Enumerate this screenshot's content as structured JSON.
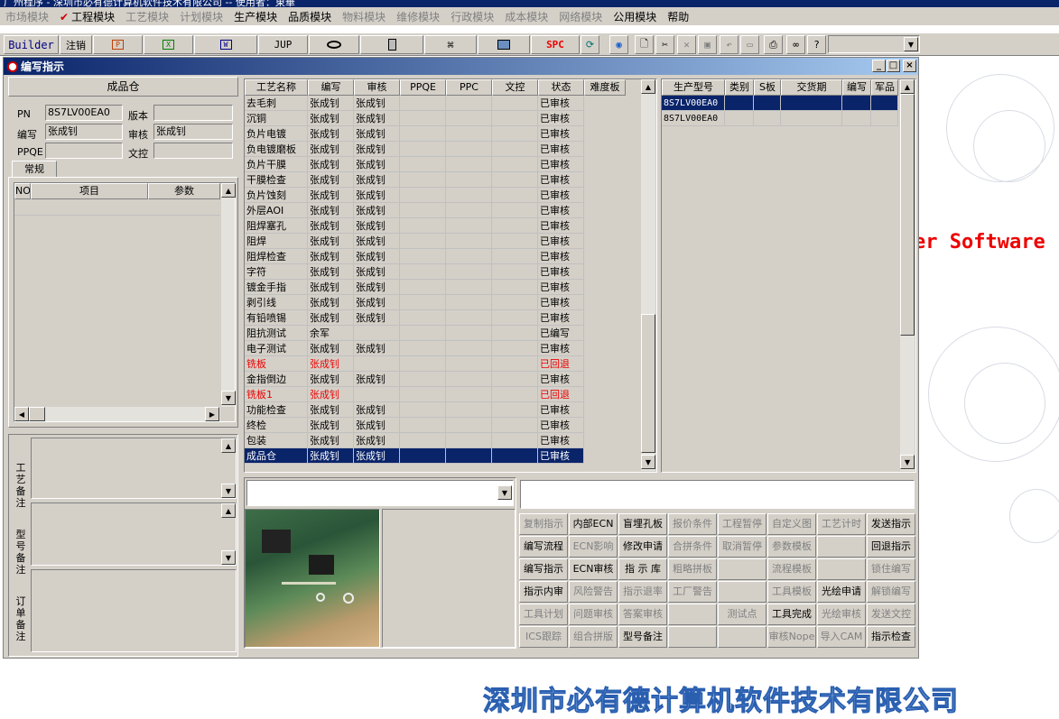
{
  "app_title": "广州程序 - 深圳市必有德计算机软件技术有限公司 -- 使用者：東華",
  "menu": [
    {
      "label": "市场模块",
      "enabled": false
    },
    {
      "label": "工程模块",
      "enabled": true,
      "checked": true
    },
    {
      "label": "工艺模块",
      "enabled": false
    },
    {
      "label": "计划模块",
      "enabled": false
    },
    {
      "label": "生产模块",
      "enabled": true
    },
    {
      "label": "品质模块",
      "enabled": true
    },
    {
      "label": "物料模块",
      "enabled": false
    },
    {
      "label": "维修模块",
      "enabled": false
    },
    {
      "label": "行政模块",
      "enabled": false
    },
    {
      "label": "成本模块",
      "enabled": false
    },
    {
      "label": "网络模块",
      "enabled": false
    },
    {
      "label": "公用模块",
      "enabled": true
    },
    {
      "label": "帮助",
      "enabled": true
    }
  ],
  "toolbar": {
    "builder": "Builder",
    "logout": "注销",
    "jup": "JUP",
    "spc": "SPC"
  },
  "window_title": "编写指示",
  "left": {
    "header": "成品仓",
    "pn_label": "PN",
    "pn_value": "8S7LV00EA0",
    "version_label": "版本",
    "version_value": "",
    "writer_label": "编写",
    "writer_value": "张成钊",
    "reviewer_label": "审核",
    "reviewer_value": "张成钊",
    "ppqe_label": "PPQE",
    "ppqe_value": "",
    "doc_label": "文控",
    "doc_value": "",
    "tab": "常规",
    "grid_cols": [
      "NO",
      "项目",
      "参数"
    ],
    "memo_labels": [
      "工艺备注",
      "型号备注",
      "订单备注"
    ]
  },
  "process_grid": {
    "columns": [
      "工艺名称",
      "编写",
      "审核",
      "PPQE",
      "PPC",
      "文控",
      "状态",
      "难度板"
    ],
    "rows": [
      {
        "name": "去毛刺",
        "writer": "张成钊",
        "reviewer": "张成钊",
        "status": "已审核"
      },
      {
        "name": "沉铜",
        "writer": "张成钊",
        "reviewer": "张成钊",
        "status": "已审核"
      },
      {
        "name": "负片电镀",
        "writer": "张成钊",
        "reviewer": "张成钊",
        "status": "已审核"
      },
      {
        "name": "负电镀磨板",
        "writer": "张成钊",
        "reviewer": "张成钊",
        "status": "已审核"
      },
      {
        "name": "负片干膜",
        "writer": "张成钊",
        "reviewer": "张成钊",
        "status": "已审核"
      },
      {
        "name": "干膜检查",
        "writer": "张成钊",
        "reviewer": "张成钊",
        "status": "已审核"
      },
      {
        "name": "负片蚀刻",
        "writer": "张成钊",
        "reviewer": "张成钊",
        "status": "已审核"
      },
      {
        "name": "外层AOI",
        "writer": "张成钊",
        "reviewer": "张成钊",
        "status": "已审核"
      },
      {
        "name": "阻焊塞孔",
        "writer": "张成钊",
        "reviewer": "张成钊",
        "status": "已审核"
      },
      {
        "name": "阻焊",
        "writer": "张成钊",
        "reviewer": "张成钊",
        "status": "已审核"
      },
      {
        "name": "阻焊检查",
        "writer": "张成钊",
        "reviewer": "张成钊",
        "status": "已审核"
      },
      {
        "name": "字符",
        "writer": "张成钊",
        "reviewer": "张成钊",
        "status": "已审核"
      },
      {
        "name": "镀金手指",
        "writer": "张成钊",
        "reviewer": "张成钊",
        "status": "已审核"
      },
      {
        "name": "剥引线",
        "writer": "张成钊",
        "reviewer": "张成钊",
        "status": "已审核"
      },
      {
        "name": "有铅喷锡",
        "writer": "张成钊",
        "reviewer": "张成钊",
        "status": "已审核"
      },
      {
        "name": "阻抗测试",
        "writer": "余军",
        "reviewer": "",
        "status": "已编写"
      },
      {
        "name": "电子测试",
        "writer": "张成钊",
        "reviewer": "张成钊",
        "status": "已审核"
      },
      {
        "name": "铣板",
        "writer": "张成钊",
        "reviewer": "",
        "status": "已回退",
        "red": true
      },
      {
        "name": "金指倒边",
        "writer": "张成钊",
        "reviewer": "张成钊",
        "status": "已审核"
      },
      {
        "name": "铣板1",
        "writer": "张成钊",
        "reviewer": "",
        "status": "已回退",
        "red": true
      },
      {
        "name": "功能检查",
        "writer": "张成钊",
        "reviewer": "张成钊",
        "status": "已审核"
      },
      {
        "name": "终检",
        "writer": "张成钊",
        "reviewer": "张成钊",
        "status": "已审核"
      },
      {
        "name": "包装",
        "writer": "张成钊",
        "reviewer": "张成钊",
        "status": "已审核"
      },
      {
        "name": "成品仓",
        "writer": "张成钊",
        "reviewer": "张成钊",
        "status": "已审核",
        "selected": true
      }
    ]
  },
  "model_grid": {
    "columns": [
      "生产型号",
      "类别",
      "S板",
      "交货期",
      "编写",
      "军品"
    ],
    "rows": [
      {
        "model": "8S7LV00EA0",
        "selected": true
      },
      {
        "model": "8S7LV00EA0",
        "selected": false
      }
    ]
  },
  "actions": [
    [
      {
        "label": "复制指示",
        "enabled": false
      },
      {
        "label": "内部ECN",
        "enabled": true
      },
      {
        "label": "盲埋孔板",
        "enabled": true
      },
      {
        "label": "报价条件",
        "enabled": false
      },
      {
        "label": "工程暂停",
        "enabled": false
      },
      {
        "label": "自定义图",
        "enabled": false
      },
      {
        "label": "工艺计时",
        "enabled": false
      },
      {
        "label": "发送指示",
        "enabled": true
      }
    ],
    [
      {
        "label": "编写流程",
        "enabled": true
      },
      {
        "label": "ECN影响",
        "enabled": false
      },
      {
        "label": "修改申请",
        "enabled": true
      },
      {
        "label": "合拼条件",
        "enabled": false
      },
      {
        "label": "取消暂停",
        "enabled": false
      },
      {
        "label": "参数模板",
        "enabled": false
      },
      {
        "label": "",
        "enabled": false
      },
      {
        "label": "回退指示",
        "enabled": true
      }
    ],
    [
      {
        "label": "编写指示",
        "enabled": true
      },
      {
        "label": "ECN审核",
        "enabled": true
      },
      {
        "label": "指 示 库",
        "enabled": true
      },
      {
        "label": "粗略拼板",
        "enabled": false
      },
      {
        "label": "",
        "enabled": false
      },
      {
        "label": "流程模板",
        "enabled": false
      },
      {
        "label": "",
        "enabled": false
      },
      {
        "label": "锁住编写",
        "enabled": false
      }
    ],
    [
      {
        "label": "指示内审",
        "enabled": true
      },
      {
        "label": "风险警告",
        "enabled": false
      },
      {
        "label": "指示退率",
        "enabled": false
      },
      {
        "label": "工厂警告",
        "enabled": false
      },
      {
        "label": "",
        "enabled": false
      },
      {
        "label": "工具模板",
        "enabled": false
      },
      {
        "label": "光绘申请",
        "enabled": true
      },
      {
        "label": "解锁编写",
        "enabled": false
      }
    ],
    [
      {
        "label": "工具计划",
        "enabled": false
      },
      {
        "label": "问题审核",
        "enabled": false
      },
      {
        "label": "答案审核",
        "enabled": false
      },
      {
        "label": "",
        "enabled": false
      },
      {
        "label": "测试点",
        "enabled": false
      },
      {
        "label": "工具完成",
        "enabled": true
      },
      {
        "label": "光绘审核",
        "enabled": false
      },
      {
        "label": "发送文控",
        "enabled": false
      }
    ],
    [
      {
        "label": "ICS跟踪",
        "enabled": false
      },
      {
        "label": "组合拼版",
        "enabled": false
      },
      {
        "label": "型号备注",
        "enabled": true
      },
      {
        "label": "",
        "enabled": false
      },
      {
        "label": "",
        "enabled": false
      },
      {
        "label": "审核Nope",
        "enabled": false
      },
      {
        "label": "导入CAM",
        "enabled": false
      },
      {
        "label": "指示检查",
        "enabled": true
      }
    ]
  ],
  "background_text": "er Software",
  "footer_company": "深圳市必有德计算机软件技术有限公司",
  "colors": {
    "selection": "#0a246a",
    "face": "#d4d0c8",
    "rollback": "#ee0000"
  }
}
